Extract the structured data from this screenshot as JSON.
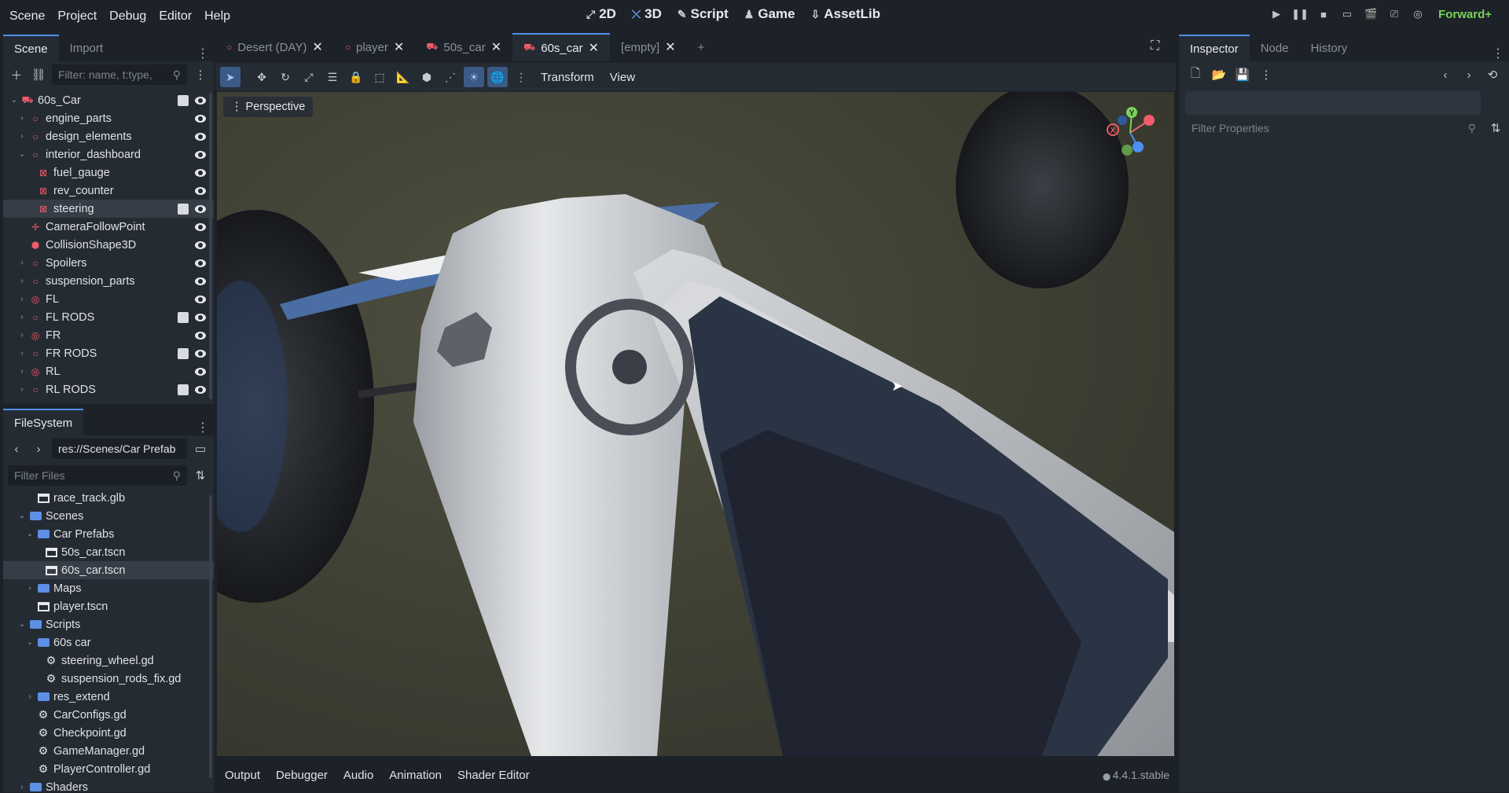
{
  "menu": [
    "Scene",
    "Project",
    "Debug",
    "Editor",
    "Help"
  ],
  "main_screens": [
    {
      "label": "2D",
      "icon": "2d-icon"
    },
    {
      "label": "3D",
      "icon": "3d-icon",
      "active": true
    },
    {
      "label": "Script",
      "icon": "script-icon"
    },
    {
      "label": "Game",
      "icon": "game-icon"
    },
    {
      "label": "AssetLib",
      "icon": "assetlib-icon"
    }
  ],
  "renderer": "Forward+",
  "scene_dock": {
    "tabs": [
      "Scene",
      "Import"
    ],
    "filter_placeholder": "Filter: name, t:type,",
    "tree": [
      {
        "label": "60s_Car",
        "icon": "vehicle-icon",
        "depth": 0,
        "expand": "open",
        "script": true
      },
      {
        "label": "engine_parts",
        "icon": "node3d-icon",
        "depth": 1,
        "expand": "closed"
      },
      {
        "label": "design_elements",
        "icon": "node3d-icon",
        "depth": 1,
        "expand": "closed"
      },
      {
        "label": "interior_dashboard",
        "icon": "node3d-icon",
        "depth": 1,
        "expand": "open"
      },
      {
        "label": "fuel_gauge",
        "icon": "mesh-icon",
        "depth": 2
      },
      {
        "label": "rev_counter",
        "icon": "mesh-icon",
        "depth": 2
      },
      {
        "label": "steering",
        "icon": "mesh-icon",
        "depth": 2,
        "script": true,
        "selected": true
      },
      {
        "label": "CameraFollowPoint",
        "icon": "marker-icon",
        "depth": 1
      },
      {
        "label": "CollisionShape3D",
        "icon": "collision-icon",
        "depth": 1
      },
      {
        "label": "Spoilers",
        "icon": "node3d-icon",
        "depth": 1,
        "expand": "closed"
      },
      {
        "label": "suspension_parts",
        "icon": "node3d-icon",
        "depth": 1,
        "expand": "closed"
      },
      {
        "label": "FL",
        "icon": "wheel-icon",
        "depth": 1,
        "expand": "closed"
      },
      {
        "label": "FL RODS",
        "icon": "node3d-icon",
        "depth": 1,
        "expand": "closed",
        "script": true
      },
      {
        "label": "FR",
        "icon": "wheel-icon",
        "depth": 1,
        "expand": "closed"
      },
      {
        "label": "FR RODS",
        "icon": "node3d-icon",
        "depth": 1,
        "expand": "closed",
        "script": true
      },
      {
        "label": "RL",
        "icon": "wheel-icon",
        "depth": 1,
        "expand": "closed"
      },
      {
        "label": "RL RODS",
        "icon": "node3d-icon",
        "depth": 1,
        "expand": "closed",
        "script": true
      }
    ]
  },
  "filesystem": {
    "title": "FileSystem",
    "path": "res://Scenes/Car Prefab",
    "filter_placeholder": "Filter Files",
    "tree": [
      {
        "label": "race_track.glb",
        "icon": "scene-file-icon",
        "depth": 2
      },
      {
        "label": "Scenes",
        "icon": "folder-icon",
        "depth": 1,
        "expand": "open"
      },
      {
        "label": "Car Prefabs",
        "icon": "folder-icon",
        "depth": 2,
        "expand": "open"
      },
      {
        "label": "50s_car.tscn",
        "icon": "scene-file-icon",
        "depth": 3
      },
      {
        "label": "60s_car.tscn",
        "icon": "scene-file-icon",
        "depth": 3,
        "selected": true
      },
      {
        "label": "Maps",
        "icon": "folder-icon",
        "depth": 2,
        "expand": "closed"
      },
      {
        "label": "player.tscn",
        "icon": "scene-file-icon",
        "depth": 2
      },
      {
        "label": "Scripts",
        "icon": "folder-icon",
        "depth": 1,
        "expand": "open"
      },
      {
        "label": "60s car",
        "icon": "folder-icon",
        "depth": 2,
        "expand": "open"
      },
      {
        "label": "steering_wheel.gd",
        "icon": "gear-icon",
        "depth": 3
      },
      {
        "label": "suspension_rods_fix.gd",
        "icon": "gear-icon",
        "depth": 3
      },
      {
        "label": "res_extend",
        "icon": "folder-icon",
        "depth": 2,
        "expand": "closed"
      },
      {
        "label": "CarConfigs.gd",
        "icon": "gear-icon",
        "depth": 2
      },
      {
        "label": "Checkpoint.gd",
        "icon": "gear-icon",
        "depth": 2
      },
      {
        "label": "GameManager.gd",
        "icon": "gear-icon",
        "depth": 2
      },
      {
        "label": "PlayerController.gd",
        "icon": "gear-icon",
        "depth": 2
      },
      {
        "label": "Shaders",
        "icon": "folder-icon",
        "depth": 1,
        "expand": "closed"
      }
    ]
  },
  "editor_tabs": [
    {
      "label": "Desert (DAY)",
      "icon": "node3d-icon"
    },
    {
      "label": "player",
      "icon": "node3d-icon"
    },
    {
      "label": "50s_car",
      "icon": "vehicle-icon"
    },
    {
      "label": "60s_car",
      "icon": "vehicle-icon",
      "active": true
    },
    {
      "label": "[empty]",
      "icon": ""
    }
  ],
  "viewport_toolbar": {
    "transform": "Transform",
    "view": "View"
  },
  "viewport": {
    "perspective_label": "Perspective",
    "gizmo": {
      "x": "X",
      "y": "Y"
    }
  },
  "inspector": {
    "tabs": [
      "Inspector",
      "Node",
      "History"
    ],
    "filter_placeholder": "Filter Properties"
  },
  "bottom_tabs": [
    "Output",
    "Debugger",
    "Audio",
    "Animation",
    "Shader Editor"
  ],
  "version": "4.4.1.stable"
}
